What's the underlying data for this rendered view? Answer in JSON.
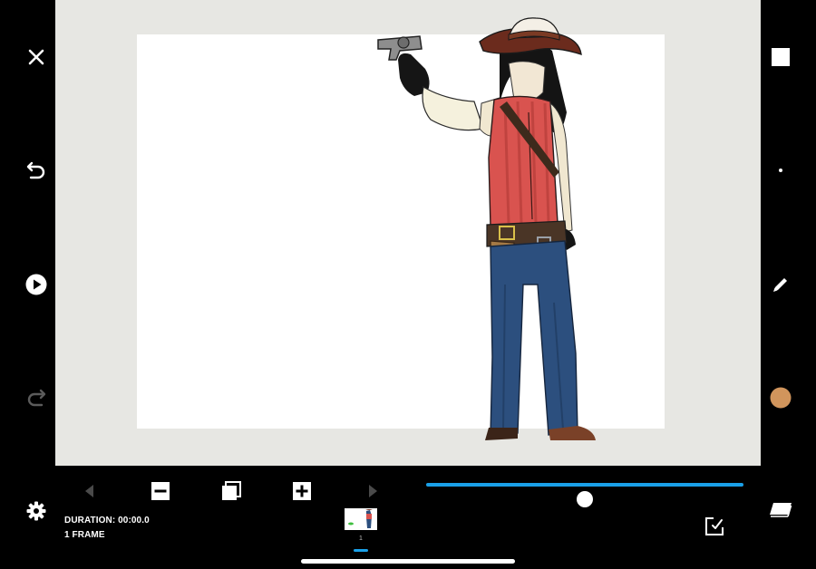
{
  "app": {
    "left_toolbar": {
      "close": "close-icon",
      "undo": "undo-icon",
      "play": "play-icon",
      "redo": "redo-icon",
      "settings": "gear-icon"
    },
    "right_toolbar": {
      "tools": [
        "square-brush-icon",
        "dot-brush-size-icon",
        "pencil-icon",
        "color-swatch-icon",
        "layers-icon"
      ],
      "current_color": "#d1955c"
    },
    "timeline": {
      "controls": [
        "prev-frame-icon",
        "remove-frame-icon",
        "duplicate-frame-icon",
        "add-frame-icon",
        "next-frame-icon"
      ],
      "slider_position": 0.5,
      "duration_label": "DURATION: 00:00.0",
      "frames_label": "1 FRAME",
      "frames": [
        {
          "number": "1"
        }
      ],
      "export": "export-icon"
    },
    "colors": {
      "accent": "#1aa0e8",
      "workspace_bg": "#e7e7e3",
      "canvas_bg": "#ffffff"
    }
  }
}
